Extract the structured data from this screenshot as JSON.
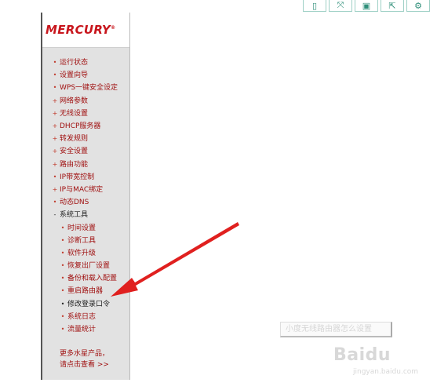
{
  "toolbar": {
    "buttons": [
      {
        "icon": "mobile-icon",
        "glyph": "▯"
      },
      {
        "icon": "expand-icon",
        "glyph": "⤧"
      },
      {
        "icon": "save-icon",
        "glyph": "▣"
      },
      {
        "icon": "share-icon",
        "glyph": "⇱"
      },
      {
        "icon": "settings-icon",
        "glyph": "⚙"
      }
    ]
  },
  "panel": {
    "logo": "MERCURY",
    "logo_mark": "®",
    "menu": [
      {
        "label": "运行状态",
        "bullet": "•",
        "level": "top"
      },
      {
        "label": "设置向导",
        "bullet": "•",
        "level": "top"
      },
      {
        "label": "WPS一键安全设定",
        "bullet": "•",
        "level": "top"
      },
      {
        "label": "网络参数",
        "bullet": "+",
        "level": "top"
      },
      {
        "label": "无线设置",
        "bullet": "+",
        "level": "top"
      },
      {
        "label": "DHCP服务器",
        "bullet": "+",
        "level": "top"
      },
      {
        "label": "转发规则",
        "bullet": "+",
        "level": "top"
      },
      {
        "label": "安全设置",
        "bullet": "+",
        "level": "top"
      },
      {
        "label": "路由功能",
        "bullet": "+",
        "level": "top"
      },
      {
        "label": "IP带宽控制",
        "bullet": "•",
        "level": "top"
      },
      {
        "label": "IP与MAC绑定",
        "bullet": "+",
        "level": "top"
      },
      {
        "label": "动态DNS",
        "bullet": "•",
        "level": "top"
      },
      {
        "label": "系统工具",
        "bullet": "-",
        "level": "top",
        "expanded": true
      },
      {
        "label": "时间设置",
        "bullet": "•",
        "level": "sub"
      },
      {
        "label": "诊断工具",
        "bullet": "•",
        "level": "sub"
      },
      {
        "label": "软件升级",
        "bullet": "•",
        "level": "sub"
      },
      {
        "label": "恢复出厂设置",
        "bullet": "•",
        "level": "sub"
      },
      {
        "label": "备份和载入配置",
        "bullet": "•",
        "level": "sub"
      },
      {
        "label": "重启路由器",
        "bullet": "•",
        "level": "sub"
      },
      {
        "label": "修改登录口令",
        "bullet": "•",
        "level": "sub",
        "expanded": true
      },
      {
        "label": "系统日志",
        "bullet": "•",
        "level": "sub"
      },
      {
        "label": "流量统计",
        "bullet": "•",
        "level": "sub"
      }
    ],
    "more_line1": "更多水星产品，",
    "more_line2": "请点击查看 >>"
  },
  "watermark": {
    "box_text": "小度无线路由器怎么设置",
    "brand": "Baidu",
    "brand_sub": "jingyan.baidu.com"
  },
  "colors": {
    "logo": "#c8161d",
    "menu_text": "#a01010",
    "panel_bg": "#e2e2e2",
    "arrow": "#e0201f"
  }
}
